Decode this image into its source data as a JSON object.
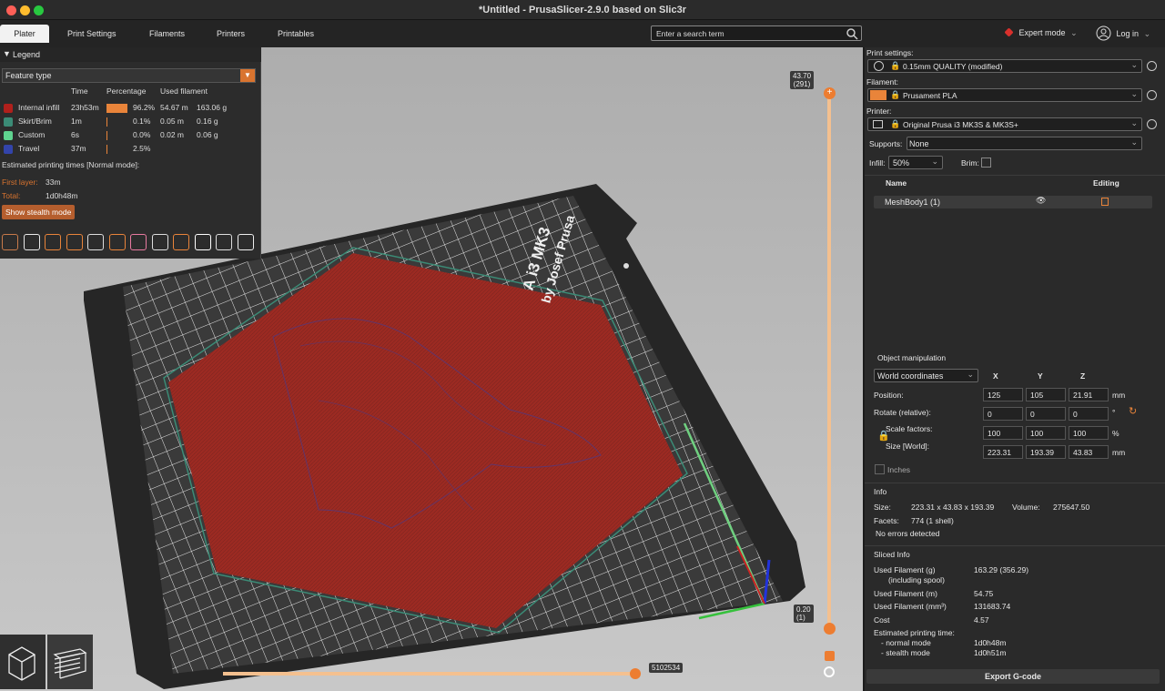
{
  "window": {
    "title": "*Untitled - PrusaSlicer-2.9.0 based on Slic3r"
  },
  "tabs": [
    "Plater",
    "Print Settings",
    "Filaments",
    "Printers",
    "Printables"
  ],
  "search": {
    "placeholder": "Enter a search term"
  },
  "mode": {
    "label": "Expert mode",
    "color": "#d9302c"
  },
  "login": {
    "label": "Log in"
  },
  "legend": {
    "title": "Legend",
    "view_type": "Feature type",
    "headers": {
      "time": "Time",
      "percentage": "Percentage",
      "used": "Used filament"
    },
    "rows": [
      {
        "name": "Internal infill",
        "color": "#b0201c",
        "time": "23h53m",
        "pct": "96.2%",
        "len": "54.67 m",
        "g": "163.06 g",
        "pct_value": 96.2
      },
      {
        "name": "Skirt/Brim",
        "color": "#3b8b76",
        "time": "1m",
        "pct": "0.1%",
        "len": "0.05 m",
        "g": "0.16 g",
        "pct_value": 0.1
      },
      {
        "name": "Custom",
        "color": "#5fd38f",
        "time": "6s",
        "pct": "0.0%",
        "len": "0.02 m",
        "g": "0.06 g",
        "pct_value": 0.0
      },
      {
        "name": "Travel",
        "color": "#3344aa",
        "time": "37m",
        "pct": "2.5%",
        "len": "",
        "g": "",
        "pct_value": 2.5
      }
    ],
    "estimated": "Estimated printing times [Normal mode]:",
    "first_layer_label": "First layer:",
    "first_layer": "33m",
    "total_label": "Total:",
    "total": "1d0h48m",
    "stealth_button": "Show stealth mode"
  },
  "sliders": {
    "top_value": "43.70",
    "top_layer": "(291)",
    "bottom_value": "0.20",
    "bottom_layer": "(1)",
    "horizontal_value": "5102534"
  },
  "right": {
    "print_settings_label": "Print settings:",
    "print_settings": "0.15mm QUALITY (modified)",
    "filament_label": "Filament:",
    "filament": "Prusament PLA",
    "filament_color": "#e9843a",
    "printer_label": "Printer:",
    "printer": "Original Prusa i3 MK3S & MK3S+",
    "supports_label": "Supports:",
    "supports": "None",
    "infill_label": "Infill:",
    "infill": "50%",
    "brim_label": "Brim:",
    "list_headers": {
      "name": "Name",
      "editing": "Editing"
    },
    "object_name": "MeshBody1 (1)",
    "manip": {
      "title": "Object manipulation",
      "coords": "World coordinates",
      "x": "X",
      "y": "Y",
      "z": "Z",
      "position_label": "Position:",
      "position": [
        "125",
        "105",
        "21.91"
      ],
      "position_unit": "mm",
      "rotate_label": "Rotate (relative):",
      "rotate": [
        "0",
        "0",
        "0"
      ],
      "rotate_unit": "°",
      "scale_label": "Scale factors:",
      "scale": [
        "100",
        "100",
        "100"
      ],
      "scale_unit": "%",
      "size_label": "Size [World]:",
      "size": [
        "223.31",
        "193.39",
        "43.83"
      ],
      "size_unit": "mm",
      "inches": "Inches"
    },
    "info": {
      "title": "Info",
      "size_label": "Size:",
      "size": "223.31 x 43.83 x 193.39",
      "volume_label": "Volume:",
      "volume": "275647.50",
      "facets_label": "Facets:",
      "facets": "774 (1 shell)",
      "errors": "No errors detected"
    },
    "sliced": {
      "title": "Sliced Info",
      "rows": [
        {
          "label": "Used Filament (g)",
          "value": "163.29 (356.29)"
        },
        {
          "label": "(including spool)",
          "value": ""
        },
        {
          "label": "Used Filament (m)",
          "value": "54.75"
        },
        {
          "label": "Used Filament (mm³)",
          "value": "131683.74"
        },
        {
          "label": "Cost",
          "value": "4.57"
        },
        {
          "label": "Estimated printing time:",
          "value": ""
        },
        {
          "label": "- normal mode",
          "value": "1d0h48m"
        },
        {
          "label": "- stealth mode",
          "value": "1d0h51m"
        }
      ]
    },
    "export_button": "Export G-code"
  },
  "bed_text": {
    "line1": "A i3 MK3",
    "line2": "by Josef Prusa"
  }
}
